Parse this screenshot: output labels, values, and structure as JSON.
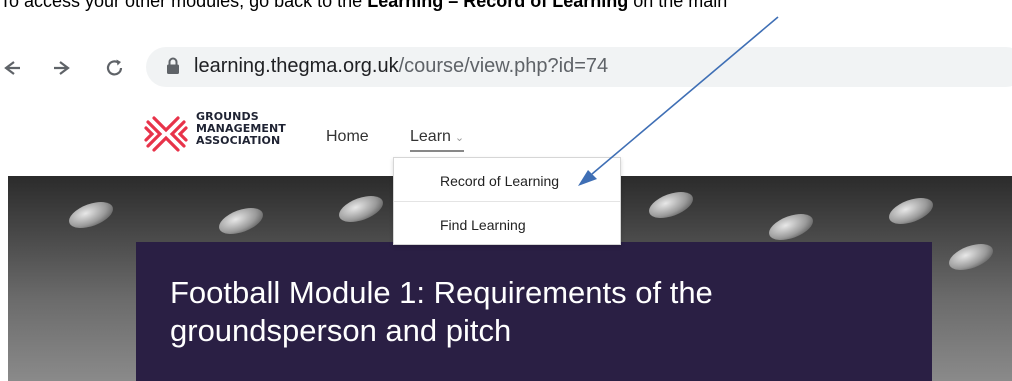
{
  "instruction": {
    "prefix": "To access your other modules, go back to the ",
    "bold1": "Learning",
    "sep": " – ",
    "bold2": "Record of Learning",
    "suffix": " on the main"
  },
  "browser": {
    "back_icon": "arrow-left-icon",
    "forward_icon": "arrow-right-icon",
    "reload_icon": "reload-icon",
    "url_domain": "learning.thegma.org.uk",
    "url_path": "/course/view.php?id=74"
  },
  "site": {
    "logo_lines": [
      "GROUNDS",
      "MANAGEMENT",
      "ASSOCIATION"
    ],
    "nav": {
      "home": "Home",
      "learn": "Learn"
    },
    "dropdown": [
      "Record of Learning",
      "Find Learning"
    ],
    "colors": {
      "logo_red": "#e8334a",
      "title_bg": "#2a1f44",
      "arrow": "#3f6fb5"
    }
  },
  "course": {
    "title": "Football Module 1: Requirements of the groundsperson and pitch"
  }
}
